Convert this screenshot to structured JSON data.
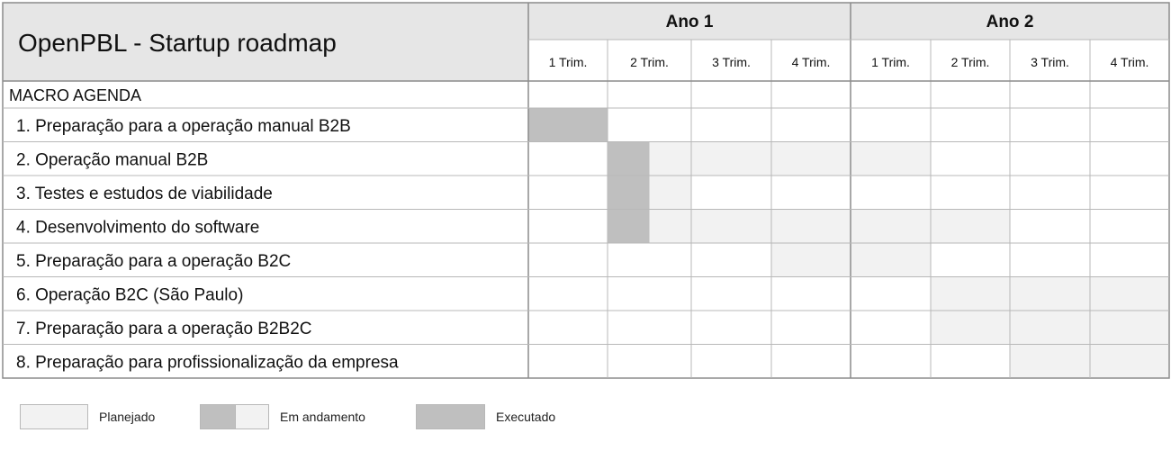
{
  "chart_data": {
    "type": "gantt",
    "title": "OpenPBL - Startup roadmap",
    "years": [
      "Ano 1",
      "Ano 2"
    ],
    "quarters": [
      "1 Trim.",
      "2 Trim.",
      "3 Trim.",
      "4 Trim.",
      "1 Trim.",
      "2 Trim.",
      "3 Trim.",
      "4 Trim."
    ],
    "section_label": "MACRO AGENDA",
    "tasks": [
      {
        "label": "1. Preparação para a operação manual B2B",
        "executed": [
          [
            0,
            1
          ]
        ],
        "planned": []
      },
      {
        "label": "2. Operação manual B2B",
        "executed": [
          [
            1,
            1.5
          ]
        ],
        "planned": [
          [
            1.5,
            5
          ]
        ]
      },
      {
        "label": "3. Testes e estudos de viabilidade",
        "executed": [
          [
            1,
            1.5
          ]
        ],
        "planned": [
          [
            1.5,
            2
          ]
        ]
      },
      {
        "label": "4. Desenvolvimento do software",
        "executed": [
          [
            1,
            1.5
          ]
        ],
        "planned": [
          [
            1.5,
            6
          ]
        ]
      },
      {
        "label": "5. Preparação para a operação B2C",
        "executed": [],
        "planned": [
          [
            3,
            5
          ]
        ]
      },
      {
        "label": "6. Operação B2C (São Paulo)",
        "executed": [],
        "planned": [
          [
            5,
            8
          ]
        ]
      },
      {
        "label": "7. Preparação para a operação B2B2C",
        "executed": [],
        "planned": [
          [
            5,
            8
          ]
        ]
      },
      {
        "label": "8. Preparação para profissionalização da empresa",
        "executed": [],
        "planned": [
          [
            6,
            8
          ]
        ]
      }
    ],
    "colors": {
      "planned": "#f2f2f2",
      "executed": "#bfbfbf",
      "grid": "#b8b8b8",
      "header_fill": "#e6e6e6"
    }
  },
  "legend": {
    "planned": "Planejado",
    "in_progress": "Em andamento",
    "executed": "Executado"
  }
}
